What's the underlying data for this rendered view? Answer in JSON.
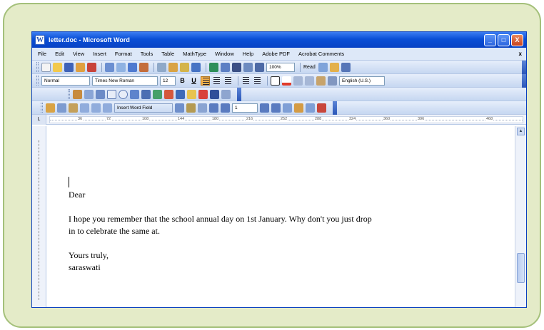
{
  "window": {
    "title": "letter.doc - Microsoft Word",
    "controls": {
      "minimize": "_",
      "maximize": "□",
      "close": "X"
    }
  },
  "menu": {
    "items": [
      "File",
      "Edit",
      "View",
      "Insert",
      "Format",
      "Tools",
      "Table",
      "MathType",
      "Window",
      "Help",
      "Adobe PDF",
      "Acrobat Comments"
    ],
    "close_glyph": "x"
  },
  "toolbar_standard": {
    "zoom": "100%",
    "read_label": "Read"
  },
  "toolbar_formatting": {
    "style": "Normal",
    "font": "Times New Roman",
    "size": "12",
    "bold": "B",
    "underline": "U",
    "language": "English (U.S.)"
  },
  "toolbar_mailmerge": {
    "insert_word_field": "Insert Word Field",
    "record": "1"
  },
  "ruler": {
    "corner": "L",
    "ticks": [
      "36",
      "72",
      "108",
      "144",
      "180",
      "216",
      "252",
      "288",
      "324",
      "360",
      "396",
      "468"
    ]
  },
  "document": {
    "lines": [
      "Dear",
      "I hope you remember that the school annual day on 1st January. Why don't you just drop",
      "in to celebrate the same at.",
      "Yours truly,",
      "saraswati"
    ]
  },
  "colors": {
    "titlebar": "#0a4fd6",
    "frame_border": "#a4c07a",
    "frame_bg": "#e4ebc8",
    "highlight": "#f7b24a"
  }
}
